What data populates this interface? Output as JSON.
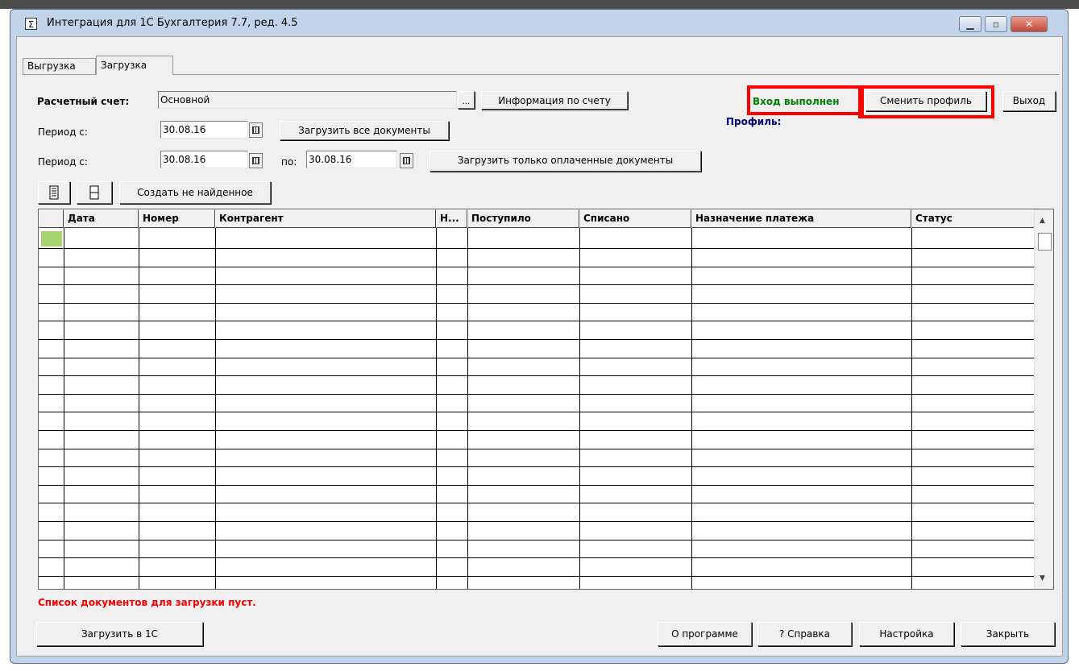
{
  "window": {
    "title": "Интеграция для 1С Бухгалтерия 7.7, ред. 4.5",
    "icon": "sigma-icon",
    "controls": {
      "minimize": "▁",
      "maximize": "▫",
      "close": "✕"
    }
  },
  "tabs": [
    {
      "label": "Выгрузка",
      "active": false
    },
    {
      "label": "Загрузка",
      "active": true
    }
  ],
  "account": {
    "label": "Расчетный счет:",
    "value": "Основной",
    "browse": "...",
    "info_button": "Информация по счету"
  },
  "login": {
    "status": "Вход выполнен",
    "change_profile": "Сменить профиль",
    "exit": "Выход",
    "profile_label": "Профиль:"
  },
  "period1": {
    "label": "Период с:",
    "from": "30.08.16",
    "load_all": "Загрузить все документы"
  },
  "period2": {
    "label": "Период с:",
    "from": "30.08.16",
    "to_label": "по:",
    "to": "30.08.16",
    "load_paid": "Загрузить только оплаченные документы"
  },
  "toolbar": {
    "check_all_icon": "checklist-icon",
    "uncheck_all_icon": "empty-list-icon",
    "create_missing": "Создать не найденное"
  },
  "table": {
    "columns": [
      "",
      "Дата",
      "Номер",
      "Контрагент",
      "Н...",
      "Поступило",
      "Списано",
      "Назначение платежа",
      "Статус"
    ],
    "rows": []
  },
  "status_message": "Список документов для загрузки пуст.",
  "footer": {
    "load_1c": "Загрузить в 1С",
    "about": "О программе",
    "help": "? Справка",
    "settings": "Настройка",
    "close": "Закрыть"
  },
  "colors": {
    "status_green": "#008000",
    "profile_blue": "#000080",
    "error_red": "#ff0000",
    "highlight_red": "#ff0000",
    "row_marker": "#a8d46f"
  }
}
